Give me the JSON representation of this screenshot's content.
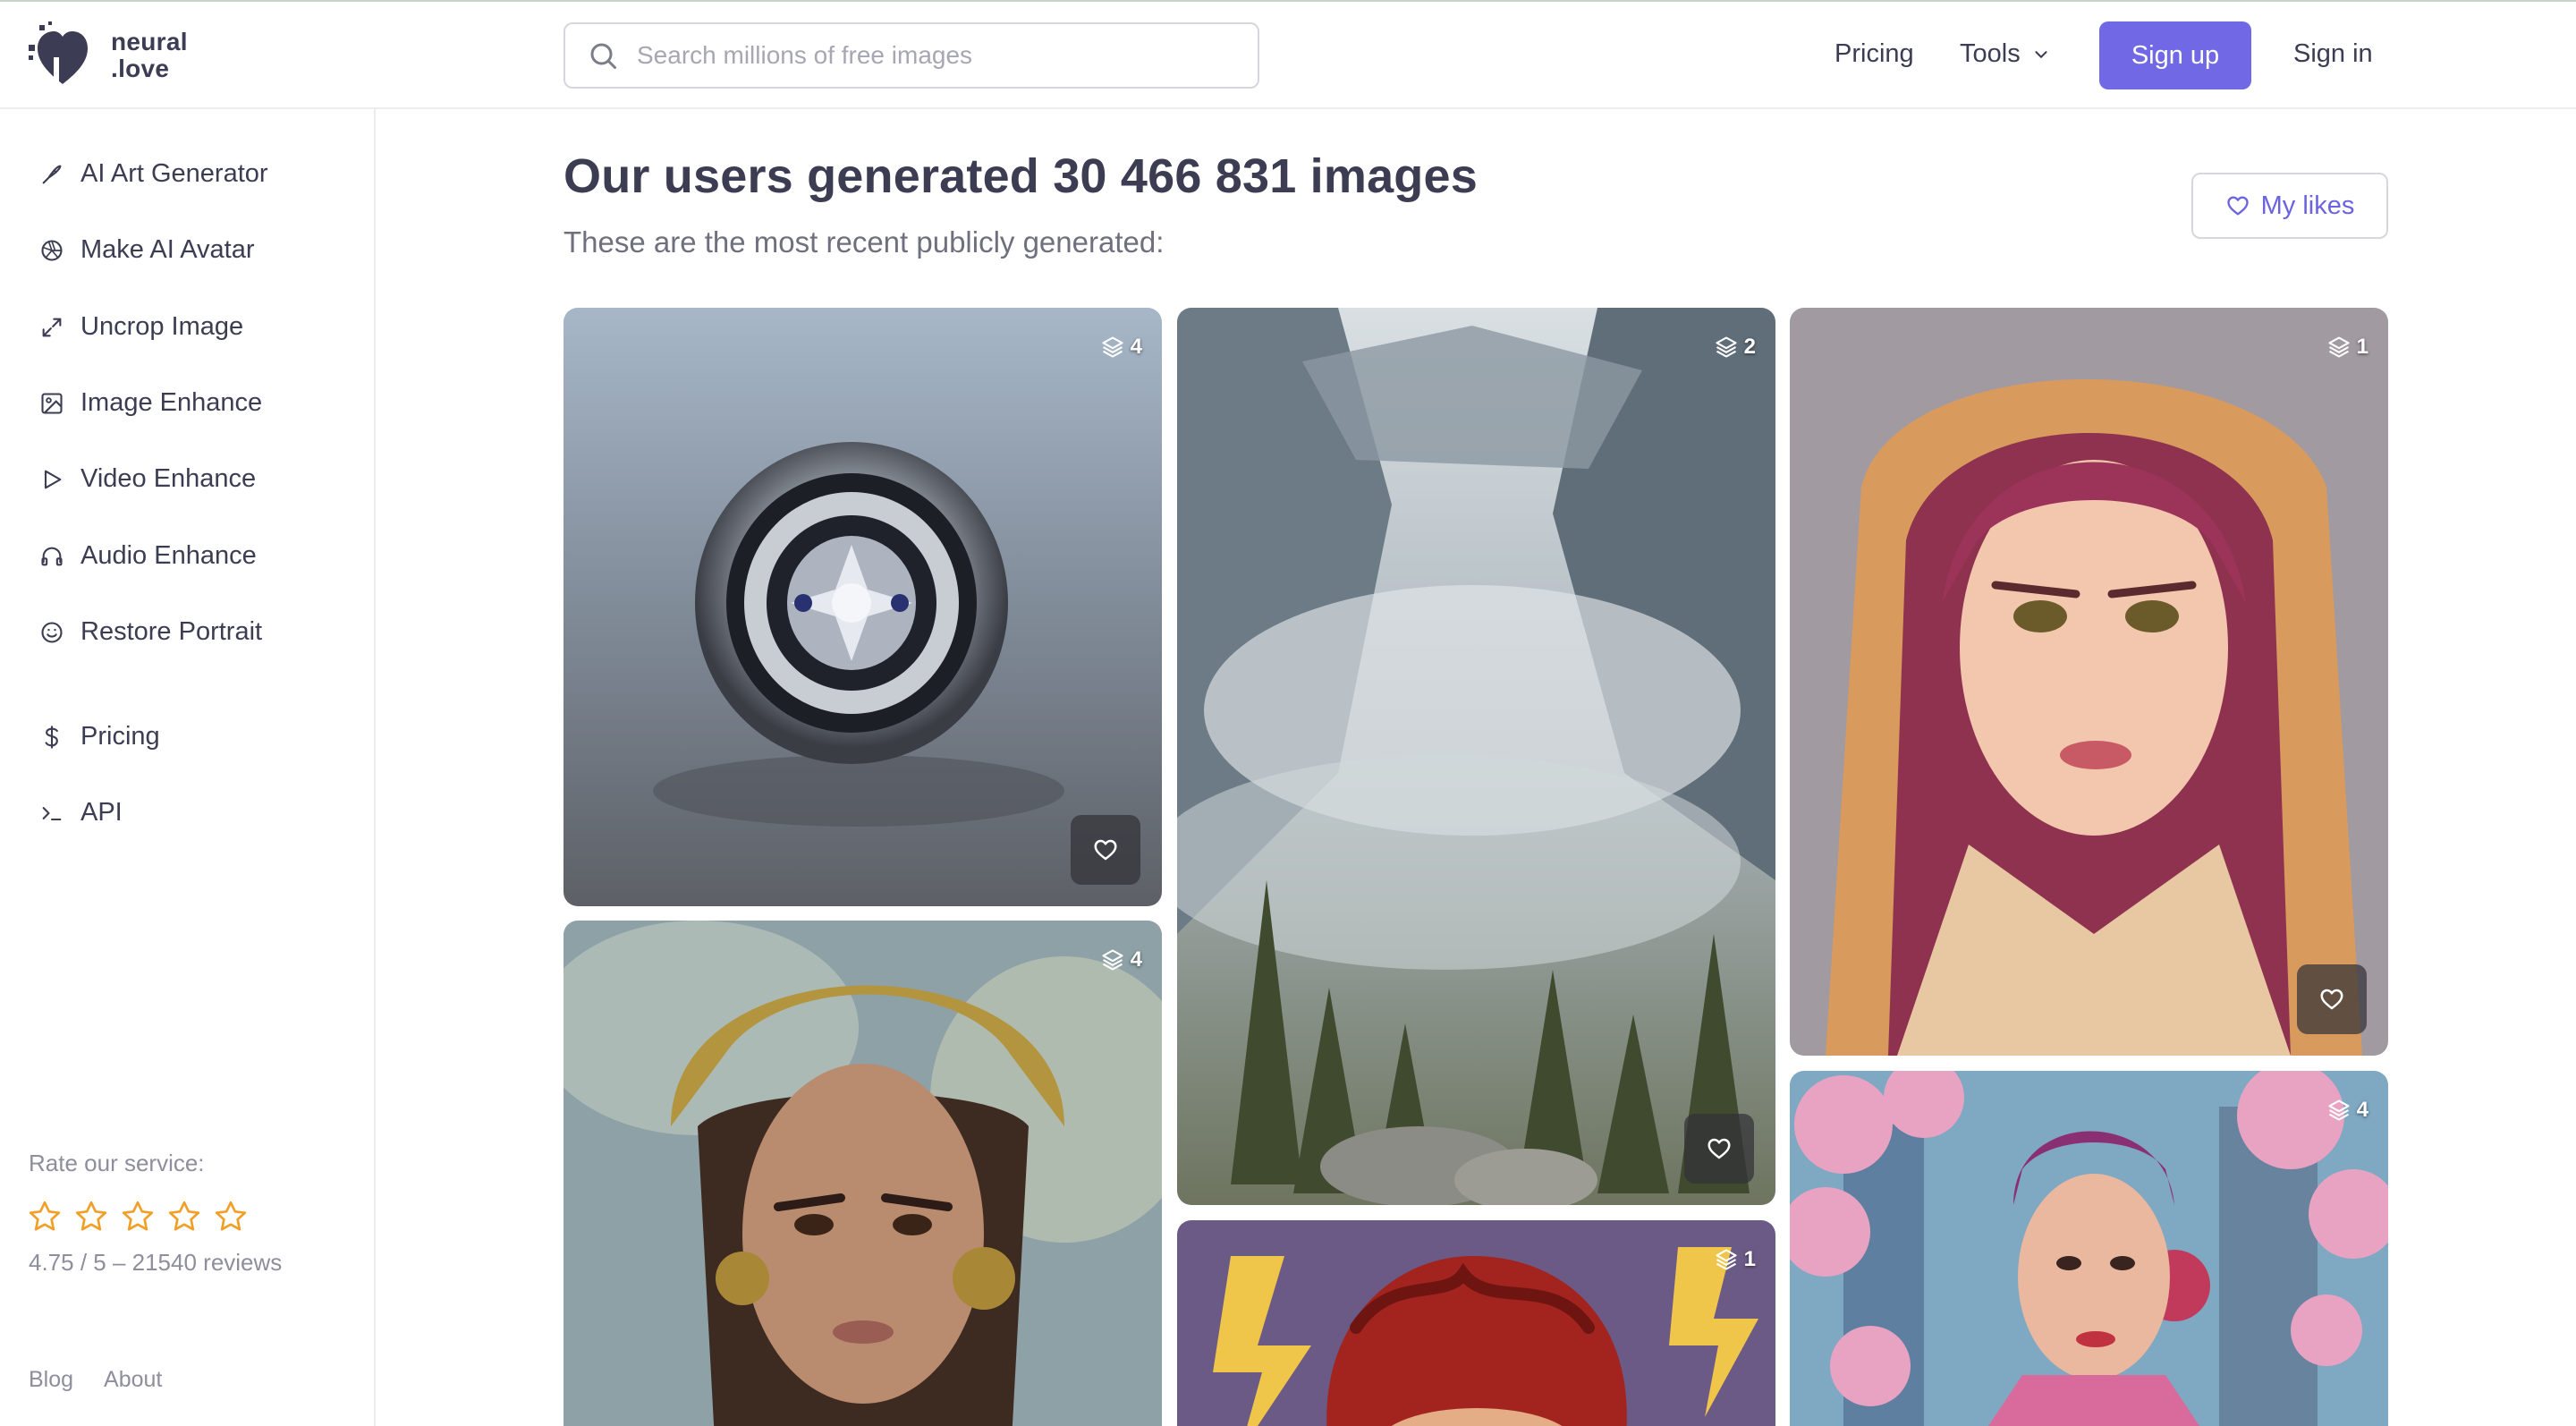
{
  "header": {
    "logo_line1": "neural",
    "logo_line2": ".love",
    "search_placeholder": "Search millions of free images",
    "nav_pricing": "Pricing",
    "nav_tools": "Tools",
    "signup": "Sign up",
    "signin": "Sign in"
  },
  "sidebar": {
    "items": [
      {
        "label": "AI Art Generator",
        "icon": "brush-icon"
      },
      {
        "label": "Make AI Avatar",
        "icon": "aperture-icon"
      },
      {
        "label": "Uncrop Image",
        "icon": "expand-icon"
      },
      {
        "label": "Image Enhance",
        "icon": "image-icon"
      },
      {
        "label": "Video Enhance",
        "icon": "play-icon"
      },
      {
        "label": "Audio Enhance",
        "icon": "headphones-icon"
      },
      {
        "label": "Restore Portrait",
        "icon": "smile-icon"
      },
      {
        "label": "Pricing",
        "icon": "dollar-icon"
      },
      {
        "label": "API",
        "icon": "terminal-icon"
      }
    ],
    "rate_label": "Rate our service:",
    "stars": 5,
    "rating_text": "4.75 / 5 – 21540 reviews",
    "footer": {
      "blog": "Blog",
      "about": "About"
    }
  },
  "main": {
    "title": "Our users generated 30 466 831 images",
    "subtitle": "These are the most recent publicly generated:",
    "my_likes": "My likes",
    "cards": [
      {
        "subject": "ornate silver ring",
        "count": "4"
      },
      {
        "subject": "misty mountain valley with pines",
        "count": "2"
      },
      {
        "subject": "anime girl with pink hair in hood",
        "count": "1"
      },
      {
        "subject": "woman with golden headdress",
        "count": "4"
      },
      {
        "subject": "woman with cherry blossoms in city",
        "count": "4"
      },
      {
        "subject": "red-haired comic character",
        "count": "1"
      }
    ]
  },
  "colors": {
    "accent": "#7168e6",
    "text": "#3c3c52",
    "muted": "#8e8e9c",
    "star": "#f0a028"
  }
}
